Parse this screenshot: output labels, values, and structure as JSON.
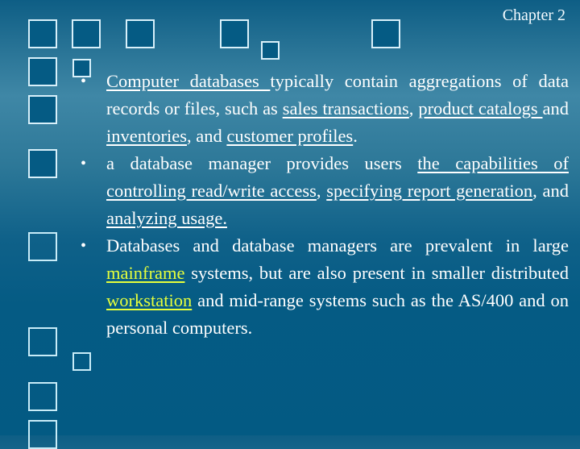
{
  "slide": {
    "header": "Chapter 2",
    "colors": {
      "background_top": "#0e5e85",
      "background_mid": "#3f87a6",
      "background_bottom": "#035a83",
      "text": "#ffffff",
      "highlight": "#e6ff3c",
      "square_fill": "#055b84",
      "square_border": "#d8f0fa"
    },
    "bullets": [
      {
        "marker": "•",
        "segments": [
          {
            "text": "Computer databases ",
            "style": "underline"
          },
          {
            "text": "typically contain aggregations of data records or files, such as ",
            "style": "plain"
          },
          {
            "text": "sales transactions",
            "style": "underline"
          },
          {
            "text": ", ",
            "style": "plain"
          },
          {
            "text": "product catalogs ",
            "style": "underline"
          },
          {
            "text": "and ",
            "style": "plain"
          },
          {
            "text": "inventories",
            "style": "underline"
          },
          {
            "text": ", and ",
            "style": "plain"
          },
          {
            "text": "customer profiles",
            "style": "underline"
          },
          {
            "text": ".",
            "style": "plain"
          }
        ]
      },
      {
        "marker": "•",
        "segments": [
          {
            "text": "a database manager provides users ",
            "style": "plain"
          },
          {
            "text": "the capabilities of controlling read/write access",
            "style": "underline"
          },
          {
            "text": ", ",
            "style": "plain"
          },
          {
            "text": "specifying report generation",
            "style": "underline"
          },
          {
            "text": ", and ",
            "style": "plain"
          },
          {
            "text": "analyzing usage.",
            "style": "underline"
          }
        ]
      },
      {
        "marker": "•",
        "segments": [
          {
            "text": " Databases and database managers are prevalent in large ",
            "style": "plain"
          },
          {
            "text": "mainframe",
            "style": "highlight"
          },
          {
            "text": " systems, but are also present in smaller distributed ",
            "style": "plain"
          },
          {
            "text": "workstation",
            "style": "highlight"
          },
          {
            "text": " and mid-range systems such as the AS/400 and on personal computers.",
            "style": "plain"
          }
        ]
      }
    ]
  }
}
